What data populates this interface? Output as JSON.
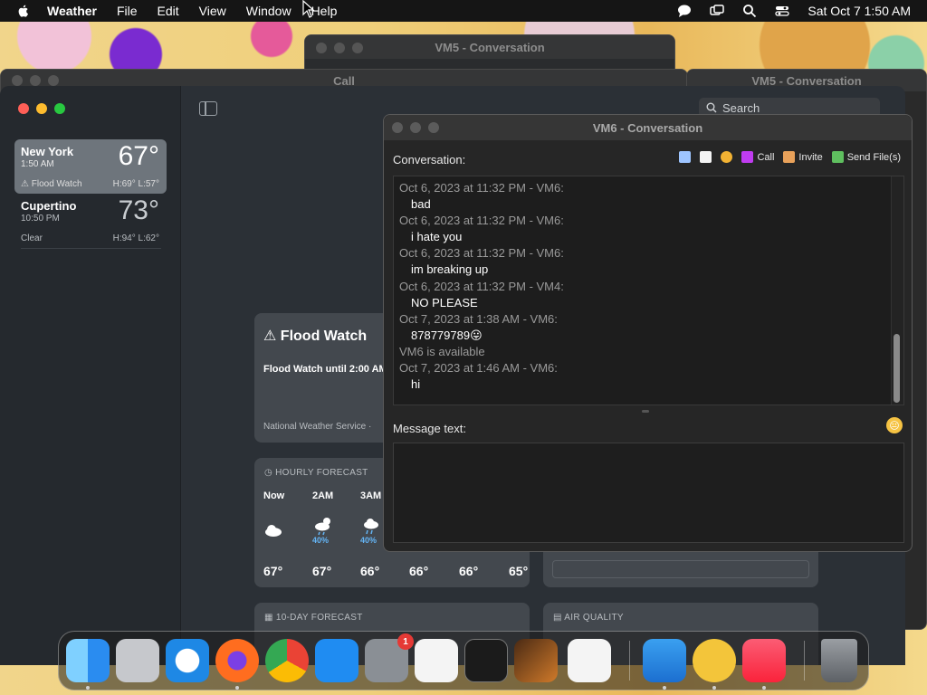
{
  "menubar": {
    "app_name": "Weather",
    "items": [
      "File",
      "Edit",
      "View",
      "Window",
      "Help"
    ],
    "datetime": "Sat Oct 7  1:50 AM"
  },
  "background_windows": {
    "vm5_top_title": "VM5 - Conversation",
    "call_title": "Call",
    "vm5_right_title": "VM5 - Conversation",
    "search_placeholder": "Search"
  },
  "weather": {
    "locations": [
      {
        "name": "New York",
        "time": "1:50 AM",
        "temp": "67°",
        "condition": "Flood Watch",
        "hilo": "H:69°  L:57°"
      },
      {
        "name": "Cupertino",
        "time": "10:50 PM",
        "temp": "73°",
        "condition": "Clear",
        "hilo": "H:94°  L:62°"
      }
    ],
    "alert": {
      "title": "Flood Watch",
      "text": "Flood Watch until 2:00 AM",
      "source": "National Weather Service ·"
    },
    "hourly": {
      "header": "HOURLY FORECAST",
      "hours": [
        {
          "label": "Now",
          "precip": "",
          "temp": "67°"
        },
        {
          "label": "2AM",
          "precip": "40%",
          "temp": "67°"
        },
        {
          "label": "3AM",
          "precip": "40%",
          "temp": "66°"
        },
        {
          "label": "",
          "precip": "",
          "temp": "66°"
        },
        {
          "label": "",
          "precip": "",
          "temp": "66°"
        },
        {
          "label": "",
          "precip": "",
          "temp": "65°"
        }
      ]
    },
    "ten_day_header": "10-DAY FORECAST",
    "air_quality_header": "AIR QUALITY"
  },
  "vm6": {
    "title": "VM6 - Conversation",
    "conversation_label": "Conversation:",
    "toolbar": {
      "call": "Call",
      "invite": "Invite",
      "send_files": "Send File(s)"
    },
    "messages": [
      {
        "header": "Oct 6, 2023 at 11:32 PM - VM6:",
        "body": "bad"
      },
      {
        "header": "Oct 6, 2023 at 11:32 PM - VM6:",
        "body": "i hate you"
      },
      {
        "header": "Oct 6, 2023 at 11:32 PM - VM6:",
        "body": "im breaking up"
      },
      {
        "header": "Oct 6, 2023 at 11:32 PM - VM4:",
        "body": "NO PLEASE"
      },
      {
        "header": "Oct 7, 2023 at 1:38 AM - VM6:",
        "body": "878779789😛"
      }
    ],
    "status": "VM6 is available",
    "last_message": {
      "header": "Oct 7, 2023 at 1:46 AM - VM6:",
      "body": "hi"
    },
    "message_label": "Message text:",
    "message_value": ""
  },
  "dock": {
    "apps": [
      "Finder",
      "Launchpad",
      "Safari",
      "Firefox",
      "Chrome",
      "App Store",
      "System Settings",
      "TextEdit",
      "Terminal",
      "GarageBand",
      "VS Code",
      "Weather",
      "Chat",
      "Music",
      "Trash"
    ],
    "settings_badge": "1"
  }
}
